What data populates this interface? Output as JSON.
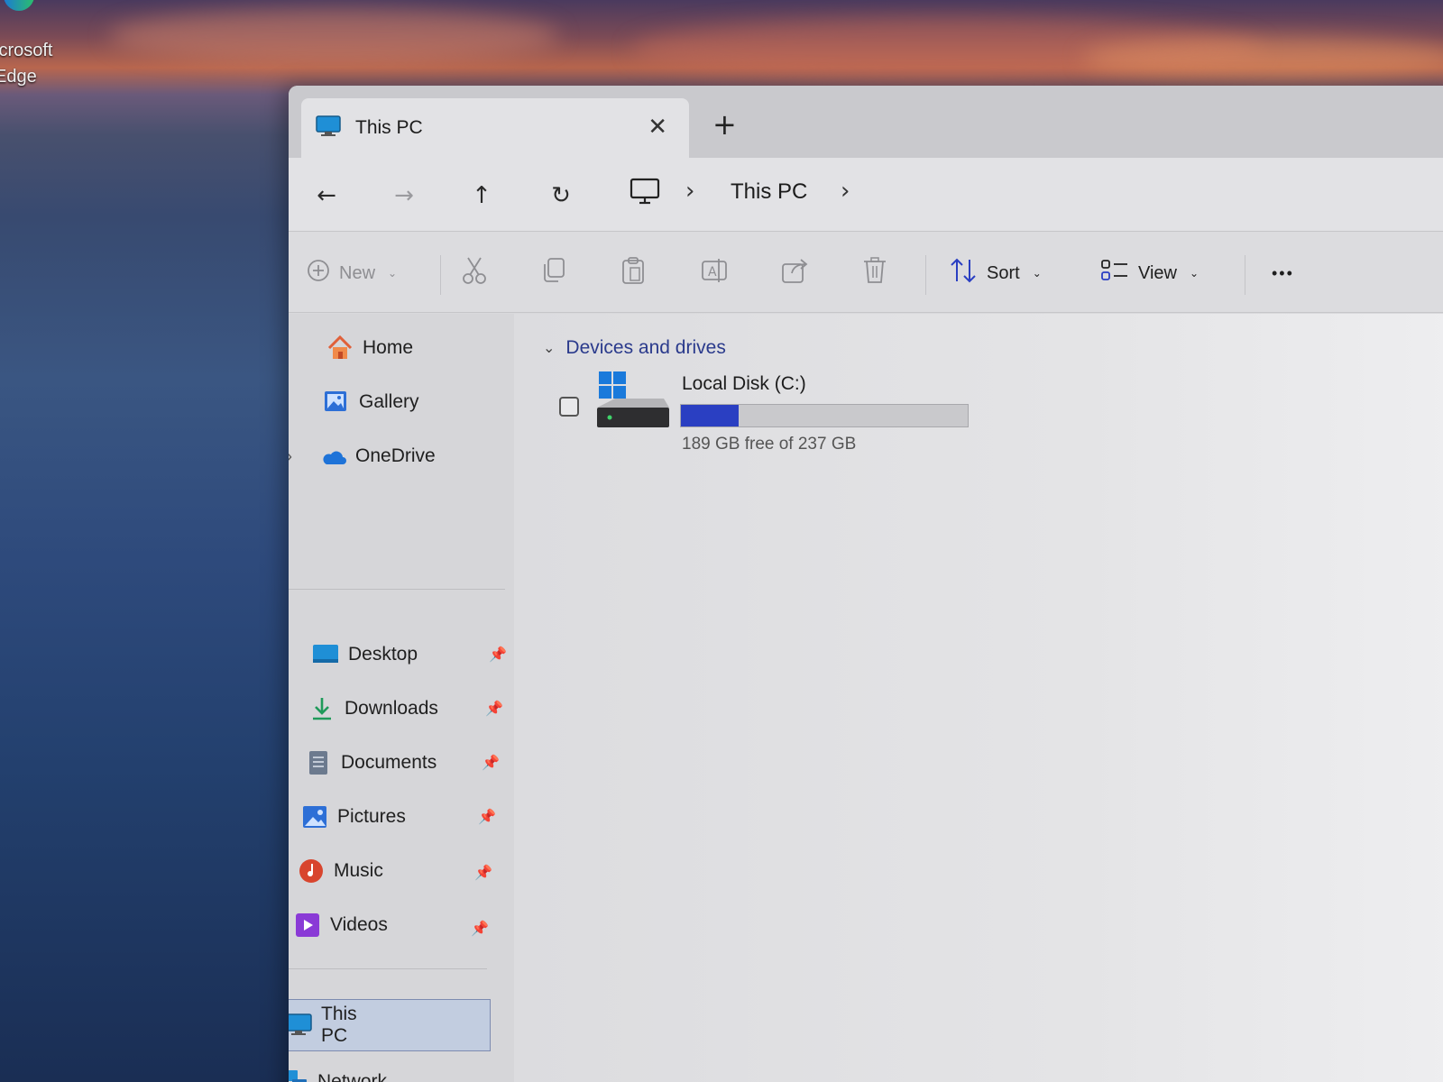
{
  "desktop": {
    "icon_label_line1": "icrosoft",
    "icon_label_line2": "Edge"
  },
  "tab": {
    "title": "This PC",
    "close_glyph": "✕",
    "new_tab_glyph": "+",
    "icon": "monitor-icon"
  },
  "nav": {
    "back": "←",
    "forward": "→",
    "up": "↑",
    "refresh": "↻",
    "breadcrumb_icon": "monitor-outline-icon",
    "breadcrumb_sep": "›",
    "breadcrumb_label": "This PC",
    "breadcrumb_trailing": "›"
  },
  "toolbar": {
    "new_label": "New",
    "sort_label": "Sort",
    "view_label": "View",
    "more_glyph": "•••",
    "caret": "⌄",
    "icons": [
      "plus-circle-icon",
      "cut-icon",
      "copy-icon",
      "paste-icon",
      "rename-icon",
      "share-icon",
      "delete-icon",
      "sort-icon",
      "view-icon",
      "more-icon"
    ]
  },
  "sidebar": {
    "items": [
      {
        "label": "Home",
        "icon": "home-icon"
      },
      {
        "label": "Gallery",
        "icon": "gallery-icon"
      },
      {
        "label": "OneDrive",
        "icon": "onedrive-icon",
        "expandable": true
      },
      {
        "label": "Desktop",
        "icon": "desktop-folder-icon",
        "pinned": true
      },
      {
        "label": "Downloads",
        "icon": "downloads-icon",
        "pinned": true
      },
      {
        "label": "Documents",
        "icon": "documents-icon",
        "pinned": true
      },
      {
        "label": "Pictures",
        "icon": "pictures-icon",
        "pinned": true
      },
      {
        "label": "Music",
        "icon": "music-icon",
        "pinned": true
      },
      {
        "label": "Videos",
        "icon": "videos-icon",
        "pinned": true
      },
      {
        "label": "This PC",
        "icon": "monitor-icon",
        "expandable": true,
        "selected": true
      },
      {
        "label": "Network",
        "icon": "network-icon",
        "expandable": true
      }
    ],
    "expander_glyph": "›",
    "pin_glyph": "📌"
  },
  "content": {
    "group_title": "Devices and drives",
    "group_caret": "⌄",
    "drives": [
      {
        "name": "Local Disk (C:)",
        "free_text": "189 GB free of 237 GB",
        "used_fraction": 0.2,
        "icon": "windows-drive-icon"
      }
    ]
  },
  "colors": {
    "accent": "#2a3fc2",
    "link": "#2a3a8c",
    "selection": "#c2cde0"
  }
}
